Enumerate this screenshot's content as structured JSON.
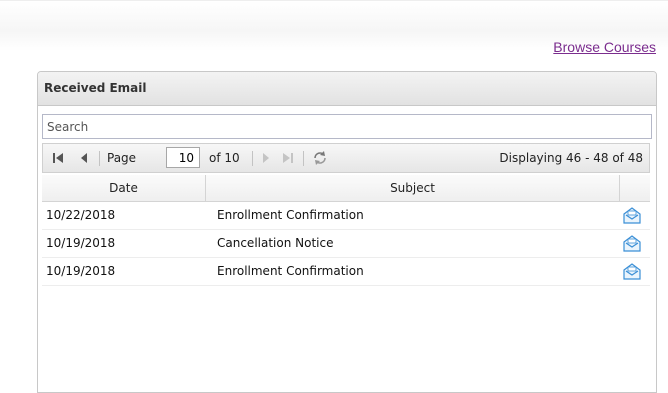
{
  "nav": {
    "browse_courses": "Browse Courses"
  },
  "panel": {
    "title": "Received Email"
  },
  "search": {
    "placeholder": "Search"
  },
  "pager": {
    "page_label": "Page",
    "current_page": "10",
    "of_label": "of 10",
    "display_text": "Displaying 46 - 48 of 48"
  },
  "columns": {
    "date": "Date",
    "subject": "Subject"
  },
  "emails": [
    {
      "date": "10/22/2018",
      "subject": "Enrollment Confirmation"
    },
    {
      "date": "10/19/2018",
      "subject": "Cancellation Notice"
    },
    {
      "date": "10/19/2018",
      "subject": "Enrollment Confirmation"
    }
  ],
  "colors": {
    "link": "#7b2d8e",
    "icon": "#3b8fd6"
  },
  "icons": [
    "first-page-icon",
    "prev-page-icon",
    "next-page-icon",
    "last-page-icon",
    "refresh-icon",
    "envelope-icon"
  ]
}
